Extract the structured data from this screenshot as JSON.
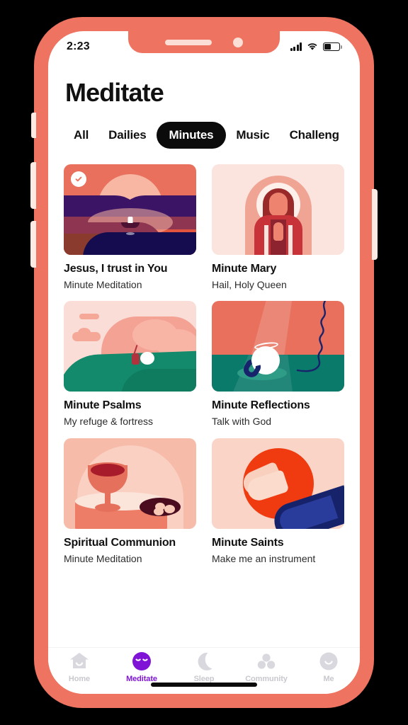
{
  "status_bar": {
    "time": "2:23",
    "signal_icon": "cellular-signal-icon",
    "wifi_icon": "wifi-icon",
    "battery_icon": "battery-icon"
  },
  "header": {
    "title": "Meditate"
  },
  "tabs": [
    {
      "label": "All",
      "active": false
    },
    {
      "label": "Dailies",
      "active": false
    },
    {
      "label": "Minutes",
      "active": true
    },
    {
      "label": "Music",
      "active": false
    },
    {
      "label": "Challeng",
      "active": false
    }
  ],
  "cards": [
    {
      "title": "Jesus, I trust in You",
      "subtitle": "Minute Meditation",
      "completed": true,
      "art": "sunset-boat-illustration"
    },
    {
      "title": "Minute Mary",
      "subtitle": "Hail, Holy Queen",
      "completed": false,
      "art": "virgin-mary-illustration"
    },
    {
      "title": "Minute Psalms",
      "subtitle": "My refuge & fortress",
      "completed": false,
      "art": "shepherd-hills-illustration"
    },
    {
      "title": "Minute Reflections",
      "subtitle": "Talk with God",
      "completed": false,
      "art": "sheep-telephone-illustration"
    },
    {
      "title": "Spiritual Communion",
      "subtitle": "Minute Meditation",
      "completed": false,
      "art": "chalice-hosts-illustration"
    },
    {
      "title": "Minute Saints",
      "subtitle": "Make me an instrument",
      "completed": false,
      "art": "praying-hands-illustration"
    }
  ],
  "bottom_nav": [
    {
      "label": "Home",
      "icon": "house-icon",
      "active": false
    },
    {
      "label": "Meditate",
      "icon": "meditating-face-icon",
      "active": true
    },
    {
      "label": "Sleep",
      "icon": "moon-icon",
      "active": false
    },
    {
      "label": "Community",
      "icon": "people-dots-icon",
      "active": false
    },
    {
      "label": "Me",
      "icon": "smile-face-icon",
      "active": false
    }
  ],
  "colors": {
    "phone_frame": "#EE7361",
    "accent_purple": "#8014D6",
    "tab_active_bg": "#0B0B0B",
    "nav_inactive": "#C8C8CE"
  }
}
